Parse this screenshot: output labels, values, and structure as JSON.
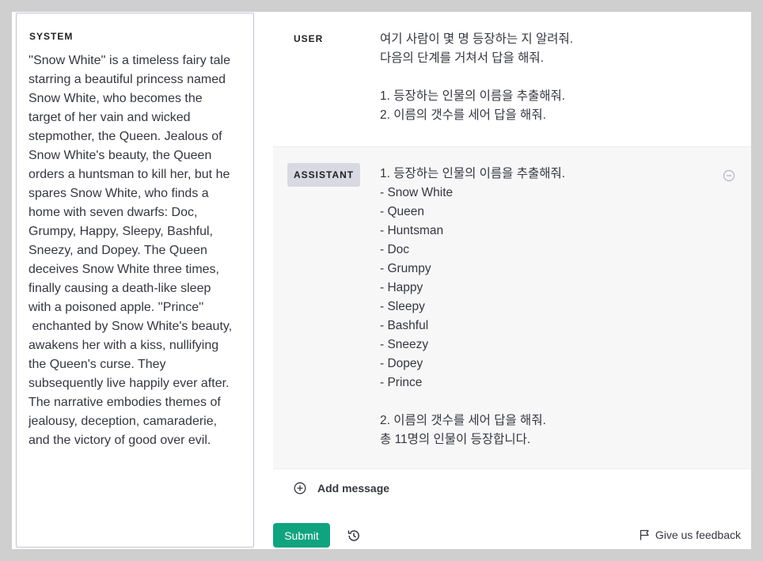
{
  "system": {
    "label": "SYSTEM",
    "text": "''Snow White'' is a timeless fairy tale\nstarring a beautiful princess named\nSnow White, who becomes the\ntarget of her vain and wicked\nstepmother, the Queen. Jealous of\nSnow White's beauty, the Queen\norders a huntsman to kill her, but he\nspares Snow White, who finds a\nhome with seven dwarfs: Doc,\nGrumpy, Happy, Sleepy, Bashful,\nSneezy, and Dopey. The Queen\ndeceives Snow White three times,\nfinally causing a death-like sleep\nwith a poisoned apple. ''Prince''\n enchanted by Snow White's beauty,\nawakens her with a kiss, nullifying\nthe Queen's curse. They\nsubsequently live happily ever after.\nThe narrative embodies themes of\njealousy, deception, camaraderie,\nand the victory of good over evil."
  },
  "messages": [
    {
      "role": "USER",
      "content": "여기 사람이 몇 명 등장하는 지 알려줘.\n다음의 단계를 거쳐서 답을 해줘.\n\n1. 등장하는 인물의 이름을 추출해줘.\n2. 이름의 갯수를 세어 답을 해줘."
    },
    {
      "role": "ASSISTANT",
      "content": "1. 등장하는 인물의 이름을 추출해줘.\n- Snow White\n- Queen\n- Huntsman\n- Doc\n- Grumpy\n- Happy\n- Sleepy\n- Bashful\n- Sneezy\n- Dopey\n- Prince\n\n2. 이름의 갯수를 세어 답을 해줘.\n총 11명의 인물이 등장합니다."
    }
  ],
  "actions": {
    "add_message": "Add message",
    "submit": "Submit",
    "feedback": "Give us feedback"
  },
  "colors": {
    "accent": "#10a37f",
    "role_badge": "#d9d9e3",
    "assistant_bg": "#f7f7f8"
  },
  "icons": {
    "add": "plus-circle-icon",
    "remove": "minus-circle-icon",
    "history": "history-icon",
    "feedback": "flag-icon"
  }
}
